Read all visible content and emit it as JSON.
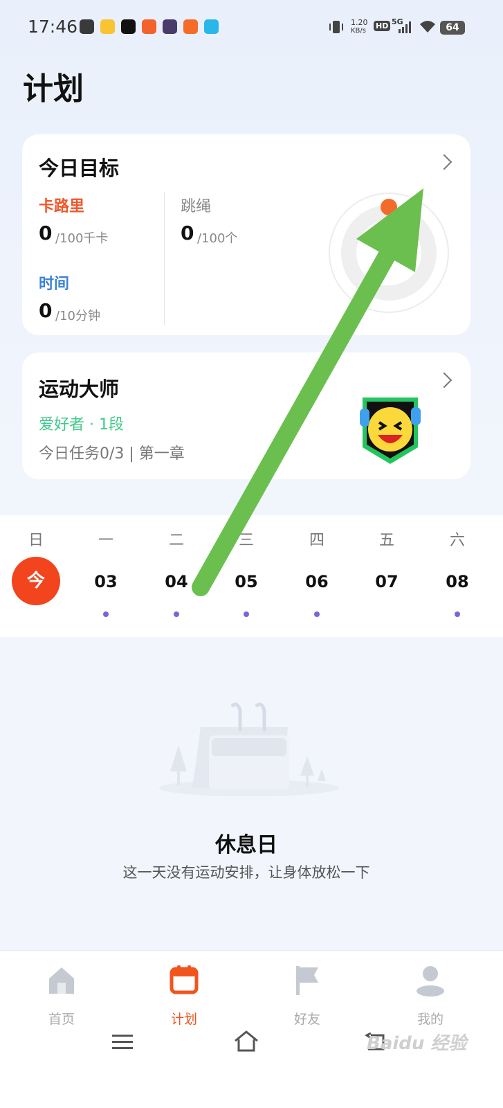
{
  "status_bar": {
    "time": "17:46",
    "speed_value": "1.20",
    "speed_unit": "KB/s",
    "hd": "HD",
    "network": "5G",
    "battery": "64"
  },
  "page": {
    "title": "计划"
  },
  "goal_card": {
    "title": "今日目标",
    "calorie": {
      "label": "卡路里",
      "value": "0",
      "unit": "/100千卡",
      "color": "#f0572a"
    },
    "time": {
      "label": "时间",
      "value": "0",
      "unit": "/10分钟",
      "color": "#3a82d6"
    },
    "rope": {
      "label": "跳绳",
      "value": "0",
      "unit": "/100个",
      "color": "#888888"
    }
  },
  "master_card": {
    "title": "运动大师",
    "level": "爱好者 · 1段",
    "task": "今日任务0/3 | 第一章"
  },
  "calendar": {
    "weekdays": [
      "日",
      "一",
      "二",
      "三",
      "四",
      "五",
      "六"
    ],
    "today_label": "今",
    "dates": [
      "03",
      "04",
      "05",
      "06",
      "07",
      "08"
    ]
  },
  "rest": {
    "title": "休息日",
    "desc": "这一天没有运动安排，让身体放松一下"
  },
  "tabs": [
    {
      "label": "首页",
      "icon": "home-icon"
    },
    {
      "label": "计划",
      "icon": "calendar-icon"
    },
    {
      "label": "好友",
      "icon": "flag-icon"
    },
    {
      "label": "我的",
      "icon": "person-icon"
    }
  ],
  "watermark": "Baidu 经验",
  "colors": {
    "accent": "#f2541d",
    "arrow": "#6bbf4e",
    "dot": "#7b63d8"
  }
}
